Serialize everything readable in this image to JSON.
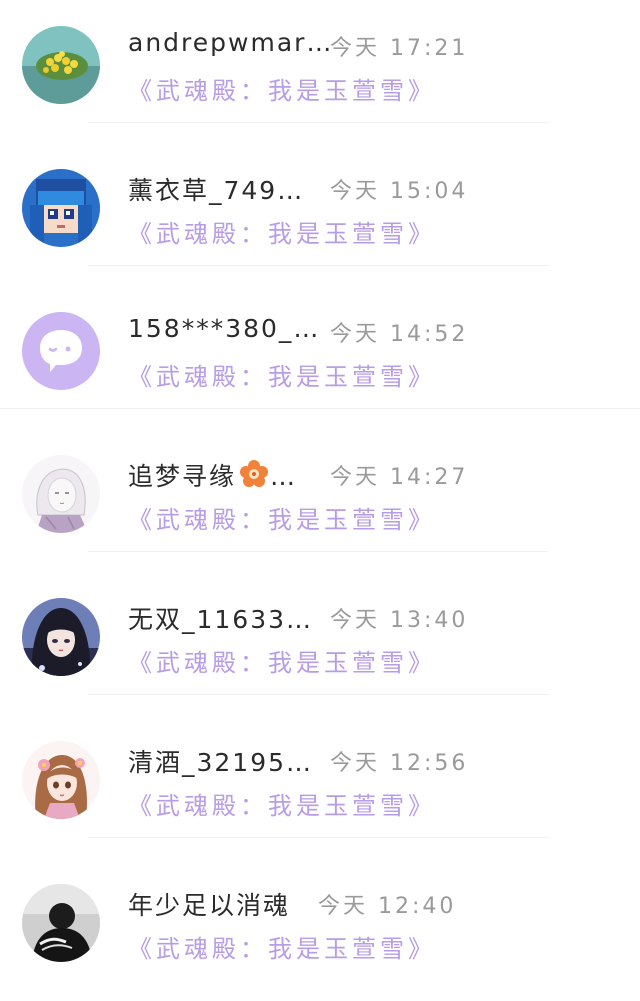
{
  "conversations": [
    {
      "name": "andrepwmar…",
      "time": "今天 17:21",
      "message": "《武魂殿：我是玉萱雪》",
      "avatar_icon": "yellow-flowers-photo"
    },
    {
      "name": "薰衣草_749…",
      "time": "今天 15:04",
      "message": "《武魂殿：我是玉萱雪》",
      "avatar_icon": "pixel-anime-blue-hair"
    },
    {
      "name": "158***380_…",
      "time": "今天 14:52",
      "message": "《武魂殿：我是玉萱雪》",
      "avatar_icon": "chat-bubble-default"
    },
    {
      "name": "追梦寻缘",
      "name_suffix": "…",
      "time": "今天 14:27",
      "message": "《武魂殿：我是玉萱雪》",
      "avatar_icon": "sketch-anime-girl"
    },
    {
      "name": "无双_11633…",
      "time": "今天 13:40",
      "message": "《武魂殿：我是玉萱雪》",
      "avatar_icon": "dark-hair-anime-girl"
    },
    {
      "name": "清酒_32195…",
      "time": "今天 12:56",
      "message": "《武魂殿：我是玉萱雪》",
      "avatar_icon": "anime-girl-flowers"
    },
    {
      "name": "年少足以消魂",
      "time": "今天 12:40",
      "message": "《武魂殿：我是玉萱雪》",
      "avatar_icon": "bw-photo-figure"
    }
  ],
  "colors": {
    "message": "#b79ce6",
    "name": "#2b2b2b",
    "time": "#9a9a9a"
  }
}
